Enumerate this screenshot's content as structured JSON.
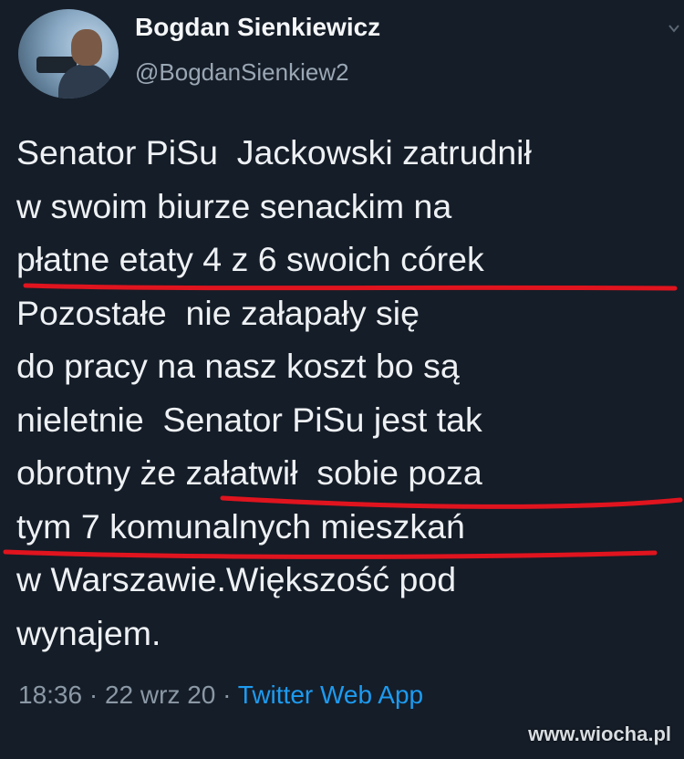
{
  "tweet": {
    "author_name": "Bogdan Sienkiewicz",
    "author_handle": "@BogdanSienkiew2",
    "lines": [
      "Senator PiSu  Jackowski zatrudnił",
      "w swoim biurze senackim na",
      "płatne etaty 4 z 6 swoich córek",
      "Pozostałe  nie załapały się",
      "do pracy na nasz koszt bo są",
      "nieletnie  Senator PiSu jest tak",
      "obrotny że załatwił  sobie poza",
      "tym 7 komunalnych mieszkań",
      "w Warszawie.Większość pod",
      "wynajem."
    ],
    "time": "18:36",
    "separator": " · ",
    "date": "22 wrz 20",
    "source": "Twitter Web App"
  },
  "watermark": "www.wiocha.pl",
  "colors": {
    "background": "#151d28",
    "underline": "#e0141e",
    "link": "#1d9bf0"
  }
}
